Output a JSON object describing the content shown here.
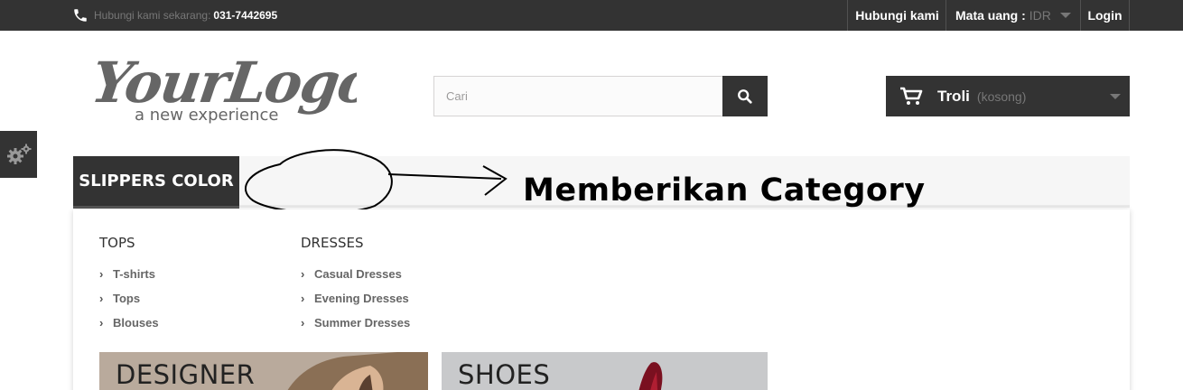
{
  "topbar": {
    "phone_label": "Hubungi kami sekarang:",
    "phone_number": "031-7442695",
    "contact_label": "Hubungi kami",
    "currency_label": "Mata uang :",
    "currency_value": "IDR",
    "login_label": "Login"
  },
  "header": {
    "logo_main": "YourLogo",
    "logo_tagline": "a new experience",
    "search_placeholder": "Cari",
    "cart_label": "Troli",
    "cart_status": "(kosong)"
  },
  "menu": {
    "active_tab": "SLIPPERS COLOR",
    "annotation": "Memberikan Category"
  },
  "dropdown": {
    "columns": [
      {
        "title": "TOPS",
        "items": [
          "T-shirts",
          "Tops",
          "Blouses"
        ]
      },
      {
        "title": "DRESSES",
        "items": [
          "Casual Dresses",
          "Evening Dresses",
          "Summer Dresses"
        ]
      }
    ],
    "banners": [
      "DESIGNER",
      "SHOES"
    ]
  },
  "colors": {
    "dark": "#333333",
    "accent_bg": "#f6f6f6"
  },
  "icons": [
    "phone-icon",
    "search-icon",
    "cart-icon",
    "gear-icon",
    "chevron-right-icon",
    "caret-down-icon"
  ]
}
